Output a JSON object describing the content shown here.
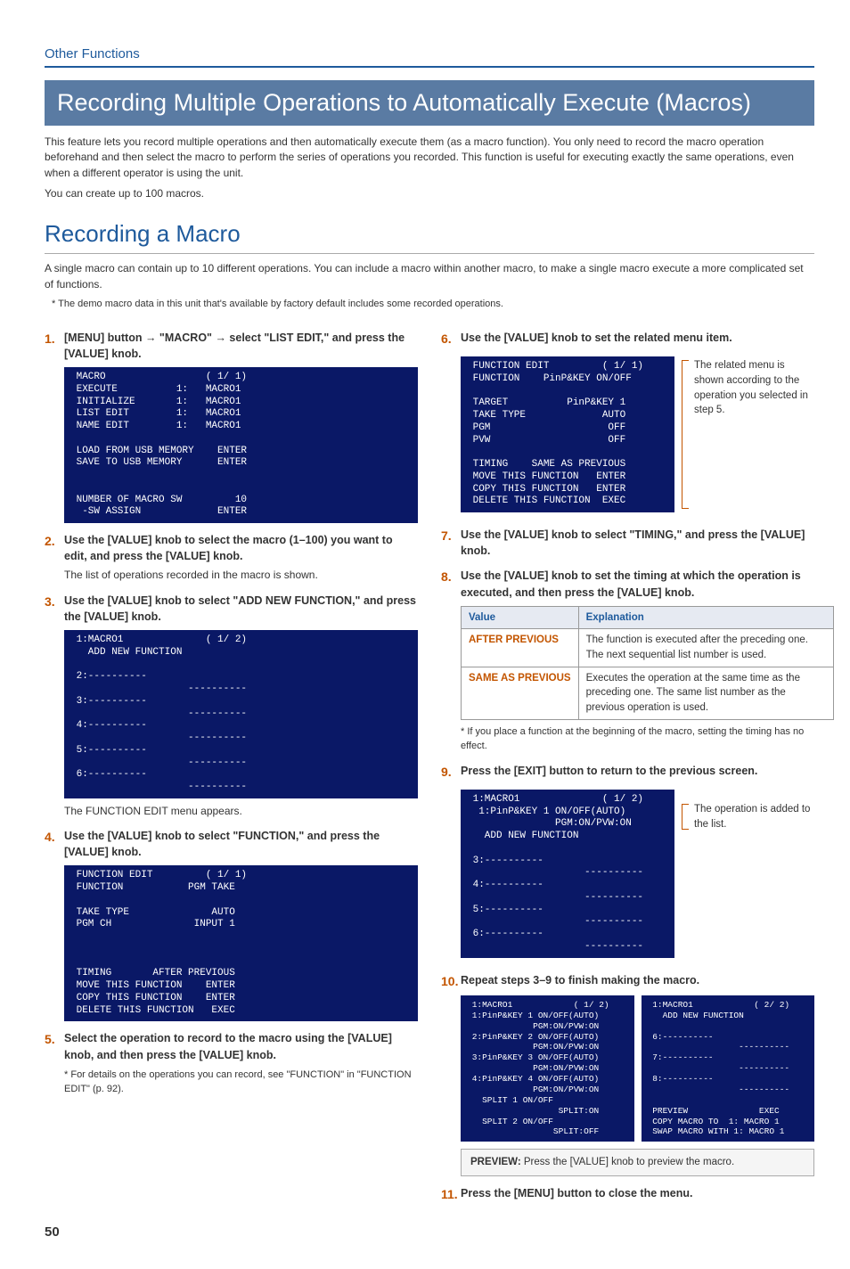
{
  "section_tag": "Other Functions",
  "h1": "Recording Multiple Operations to Automatically Execute (Macros)",
  "intro1": "This feature lets you record multiple operations and then automatically execute them (as a macro function). You only need to record the macro operation beforehand and then select the macro to perform the series of operations you recorded. This function is useful for executing exactly the same operations, even when a different operator is using the unit.",
  "intro2": "You can create up to 100 macros.",
  "h2": "Recording a Macro",
  "sub_intro": "A single macro can contain up to 10 different operations. You can include a macro within another macro, to make a single macro execute a more complicated set of functions.",
  "sub_note": "The demo macro data in this unit that's available by factory default includes some recorded operations.",
  "steps": {
    "s1": "[MENU] button → \"MACRO\" → select \"LIST EDIT,\" and press the [VALUE] knob.",
    "s2": "Use the [VALUE] knob to select the macro (1–100) you want to edit, and press the [VALUE] knob.",
    "s2_sub": "The list of operations recorded in the macro is shown.",
    "s3": "Use the [VALUE] knob to select \"ADD NEW FUNCTION,\" and press the [VALUE] knob.",
    "s3_sub": "The FUNCTION EDIT menu appears.",
    "s4": "Use the [VALUE] knob to select \"FUNCTION,\" and press the [VALUE] knob.",
    "s5": "Select the operation to record to the macro using the [VALUE] knob, and then press the [VALUE] knob.",
    "s5_note": "For details on the operations you can record, see \"FUNCTION\" in \"FUNCTION EDIT\" (p. 92).",
    "s6": "Use the [VALUE] knob to set the related menu item.",
    "s6_callout": "The related menu is shown according to the operation you selected in step 5.",
    "s7": "Use the [VALUE] knob to select \"TIMING,\" and press the [VALUE] knob.",
    "s8": "Use the [VALUE] knob to set the timing at which the operation is executed, and then press the [VALUE] knob.",
    "s8_note": "If you place a function at the beginning of the macro, setting the timing has no effect.",
    "s9": "Press the [EXIT] button to return to the previous screen.",
    "s9_callout": "The operation is added to the list.",
    "s10": "Repeat steps 3–9 to finish making the macro.",
    "s10_preview_label": "PREVIEW:",
    "s10_preview_text": " Press the [VALUE] knob to preview the macro.",
    "s11": "Press the [MENU] button to close the menu."
  },
  "table": {
    "h_value": "Value",
    "h_expl": "Explanation",
    "rows": [
      {
        "v": "AFTER PREVIOUS",
        "e": "The function is executed after the preceding one. The next sequential list number is used."
      },
      {
        "v": "SAME AS PREVIOUS",
        "e": "Executes the operation at the same time as the preceding one. The same list number as the previous operation is used."
      }
    ]
  },
  "screens": {
    "menu1": " MACRO                 ( 1/ 1)\n EXECUTE          1:   MACRO1\n INITIALIZE       1:   MACRO1\n LIST EDIT        1:   MACRO1\n NAME EDIT        1:   MACRO1\n\n LOAD FROM USB MEMORY    ENTER\n SAVE TO USB MEMORY      ENTER\n\n\n NUMBER OF MACRO SW         10\n  -SW ASSIGN             ENTER",
    "menu3": " 1:MACRO1              ( 1/ 2)\n   ADD NEW FUNCTION\n\n 2:----------\n                    ----------\n 3:----------\n                    ----------\n 4:----------\n                    ----------\n 5:----------\n                    ----------\n 6:----------\n                    ----------",
    "menu4": " FUNCTION EDIT         ( 1/ 1)\n FUNCTION           PGM TAKE\n\n TAKE TYPE              AUTO\n PGM CH              INPUT 1\n\n\n\n TIMING       AFTER PREVIOUS\n MOVE THIS FUNCTION    ENTER\n COPY THIS FUNCTION    ENTER\n DELETE THIS FUNCTION   EXEC",
    "menu6": " FUNCTION EDIT         ( 1/ 1)\n FUNCTION    PinP&KEY ON/OFF\n\n TARGET          PinP&KEY 1\n TAKE TYPE             AUTO\n PGM                    OFF\n PVW                    OFF\n\n TIMING    SAME AS PREVIOUS\n MOVE THIS FUNCTION   ENTER\n COPY THIS FUNCTION   ENTER\n DELETE THIS FUNCTION  EXEC",
    "menu9": " 1:MACRO1              ( 1/ 2)\n  1:PinP&KEY 1 ON/OFF(AUTO)\n               PGM:ON/PVW:ON\n   ADD NEW FUNCTION\n\n 3:----------\n                    ----------\n 4:----------\n                    ----------\n 5:----------\n                    ----------\n 6:----------\n                    ----------",
    "menu10a": " 1:MACRO1            ( 1/ 2)\n 1:PinP&KEY 1 ON/OFF(AUTO)\n             PGM:ON/PVW:ON\n 2:PinP&KEY 2 ON/OFF(AUTO)\n             PGM:ON/PVW:ON\n 3:PinP&KEY 3 ON/OFF(AUTO)\n             PGM:ON/PVW:ON\n 4:PinP&KEY 4 ON/OFF(AUTO)\n             PGM:ON/PVW:ON\n   SPLIT 1 ON/OFF\n                  SPLIT:ON\n   SPLIT 2 ON/OFF\n                 SPLIT:OFF",
    "menu10b": " 1:MACRO1            ( 2/ 2)\n   ADD NEW FUNCTION\n\n 6:----------\n                  ----------\n 7:----------\n                  ----------\n 8:----------\n                  ----------\n\n PREVIEW              EXEC\n COPY MACRO TO  1: MACRO 1\n SWAP MACRO WITH 1: MACRO 1"
  },
  "page_number": "50"
}
